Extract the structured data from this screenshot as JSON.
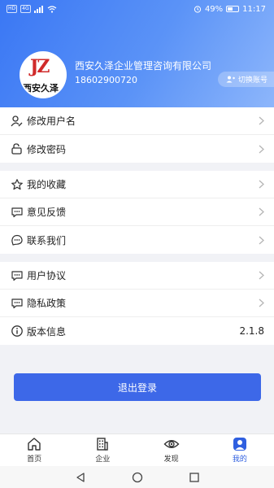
{
  "status_bar": {
    "left_chips": [
      "HD",
      "4G"
    ],
    "battery": "49%",
    "time": "11:17"
  },
  "profile": {
    "logo_letters": "JZ",
    "logo_text": "西安久泽",
    "company": "西安久泽企业管理咨询有限公司",
    "phone": "18602900720",
    "switch_label": "切换账号"
  },
  "groups": [
    [
      {
        "icon": "user-edit-icon",
        "label": "修改用户名"
      },
      {
        "icon": "lock-edit-icon",
        "label": "修改密码"
      }
    ],
    [
      {
        "icon": "star-icon",
        "label": "我的收藏"
      },
      {
        "icon": "feedback-icon",
        "label": "意见反馈"
      },
      {
        "icon": "contact-icon",
        "label": "联系我们"
      }
    ],
    [
      {
        "icon": "agreement-icon",
        "label": "用户协议"
      },
      {
        "icon": "privacy-icon",
        "label": "隐私政策"
      },
      {
        "icon": "info-icon",
        "label": "版本信息",
        "value": "2.1.8"
      }
    ]
  ],
  "logout_label": "退出登录",
  "tabs": [
    {
      "icon": "home-icon",
      "label": "首页",
      "active": false
    },
    {
      "icon": "building-icon",
      "label": "企业",
      "active": false
    },
    {
      "icon": "eye-icon",
      "label": "发现",
      "active": false
    },
    {
      "icon": "person-icon",
      "label": "我的",
      "active": true
    }
  ],
  "colors": {
    "accent": "#3d68e8",
    "tab_active": "#2f5fe0"
  }
}
